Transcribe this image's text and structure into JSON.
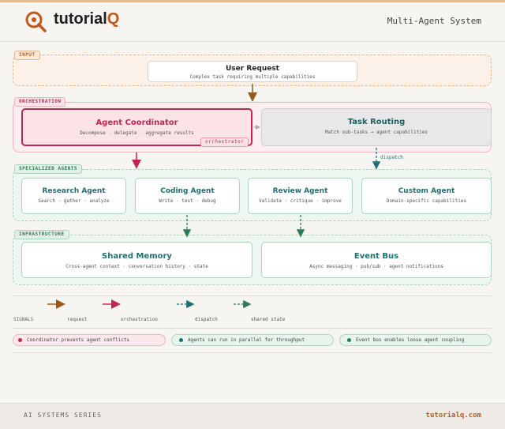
{
  "header": {
    "brand_prefix": "tutorial",
    "brand_suffix": "Q",
    "title": "Multi-Agent System"
  },
  "layers": {
    "input": "INPUT",
    "orchestration": "ORCHESTRATION",
    "specialized": "SPECIALIZED AGENTS",
    "infrastructure": "INFRASTRUCTURE"
  },
  "nodes": {
    "user_request": {
      "title": "User Request",
      "subtitle": "Complex task requiring multiple capabilities"
    },
    "coordinator": {
      "title": "Agent Coordinator",
      "subtitle": "Decompose · delegate · aggregate results",
      "badge": "orchestrator"
    },
    "task_routing": {
      "title": "Task Routing",
      "subtitle": "Match sub-tasks → agent capabilities"
    },
    "research": {
      "title": "Research Agent",
      "subtitle": "Search · gather · analyze"
    },
    "coding": {
      "title": "Coding Agent",
      "subtitle": "Write · test · debug"
    },
    "review": {
      "title": "Review Agent",
      "subtitle": "Validate · critique · improve"
    },
    "custom": {
      "title": "Custom Agent",
      "subtitle": "Domain-specific capabilities"
    },
    "memory": {
      "title": "Shared Memory",
      "subtitle": "Cross-agent context · conversation history · state"
    },
    "event_bus": {
      "title": "Event Bus",
      "subtitle": "Async messaging · pub/sub · agent notifications"
    }
  },
  "edge_labels": {
    "dispatch": "dispatch"
  },
  "legend": {
    "title": "SIGNALS",
    "items": [
      {
        "label": "request",
        "color": "#9a5a1e",
        "style": "solid"
      },
      {
        "label": "orchestration",
        "color": "#c0264f",
        "style": "solid"
      },
      {
        "label": "dispatch",
        "color": "#1f6f72",
        "style": "dashed"
      },
      {
        "label": "shared state",
        "color": "#2f7a52",
        "style": "dashed"
      }
    ]
  },
  "notes": [
    {
      "text": "Coordinator prevents agent conflicts",
      "color": "#c0264f"
    },
    {
      "text": "Agents can run in parallel for throughput",
      "color": "#1f6f72"
    },
    {
      "text": "Event bus enables loose agent coupling",
      "color": "#2f7a52"
    }
  ],
  "footer": {
    "series": "AI SYSTEMS SERIES",
    "site": "tutorialq.com"
  },
  "colors": {
    "input": "#d98a3e",
    "orchestration": "#c0264f",
    "agents": "#2f7a52",
    "dispatch": "#1f6f72",
    "accent": "#c2571c"
  }
}
